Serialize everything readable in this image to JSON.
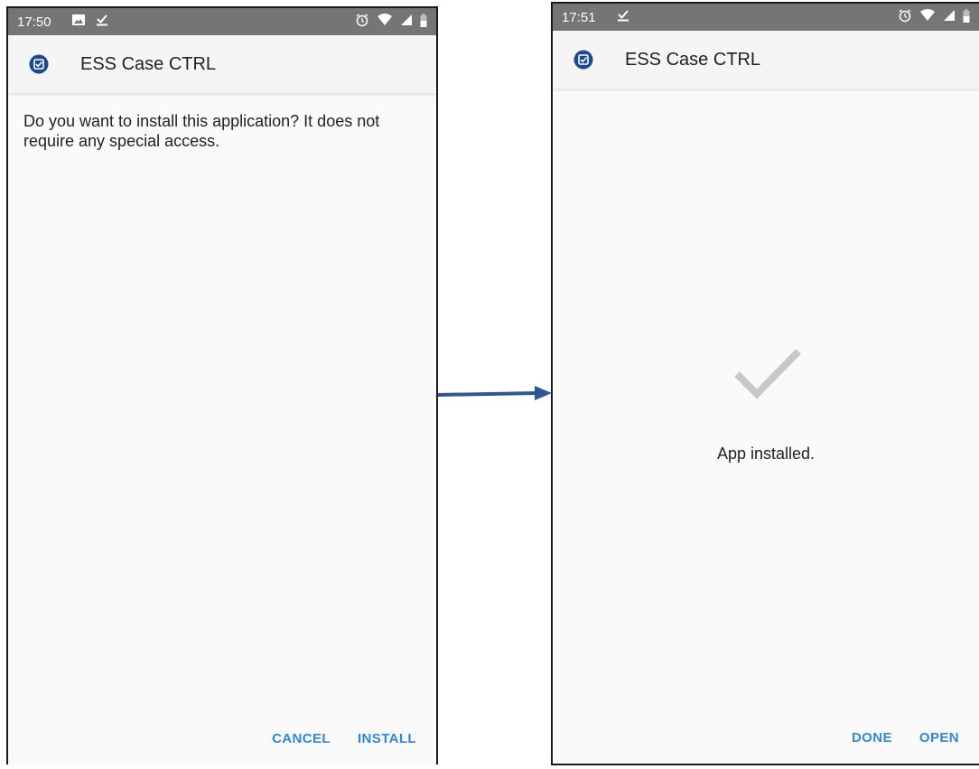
{
  "left_screen": {
    "status_time": "17:50",
    "app_title": "ESS Case CTRL",
    "message": "Do you want to install this application? It does not require any special access.",
    "cancel_label": "CANCEL",
    "install_label": "INSTALL"
  },
  "right_screen": {
    "status_time": "17:51",
    "app_title": "ESS Case CTRL",
    "status_message": "App installed.",
    "done_label": "DONE",
    "open_label": "OPEN"
  },
  "icons": {
    "status_left": [
      "image-icon",
      "download-done-icon"
    ],
    "status_right": [
      "alarm-icon",
      "wifi-icon",
      "signal-icon",
      "battery-icon"
    ],
    "app": "app-checkbox-icon",
    "success": "checkmark-icon"
  },
  "colors": {
    "accent": "#2f87d9",
    "status_bar": "#757575",
    "app_icon": "#1a4b8c",
    "arrow": "#2e5597",
    "check": "#c8c8c8"
  }
}
